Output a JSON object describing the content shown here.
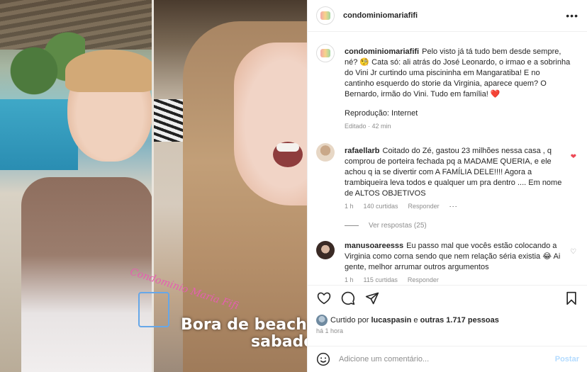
{
  "header": {
    "username": "condominiomariafifi",
    "more_icon": "more-horizontal-icon"
  },
  "media": {
    "watermark_text": "Condominio Maria Fifi",
    "overlay_line1": "Bora de beachzin",
    "overlay_line2": "sabado"
  },
  "caption": {
    "username": "condominiomariafifi",
    "text": "Pelo visto já tá tudo bem desde sempre, né? 🧐 Cata só: ali atrás do José Leonardo, o irmao e a sobrinha do Vini Jr curtindo uma piscininha em Mangaratiba! E no cantinho esquerdo do storie da Virginia, aparece quem? O Bernardo, irmão do Vini. Tudo em família! ❤️",
    "reproduction": "Reprodução: Internet",
    "edited": "Editado · 42 min"
  },
  "comments": [
    {
      "username": "rafaellarb",
      "text": "Coitado do Zé, gastou 23 milhões nessa casa , q comprou de porteira fechada pq a MADAME QUERIA, e ele achou q ia se divertir com A FAMÍLIA DELE!!!! Agora a trambiqueira leva todos e qualquer um pra dentro .... Em nome de ALTOS OBJETIVOS",
      "time": "1 h",
      "likes": "140 curtidas",
      "reply": "Responder",
      "view_replies": "Ver respostas (25)"
    },
    {
      "username": "manusoareesss",
      "text": "Eu passo mal que vocês estão colocando a Virginia como corna sendo que nem relação séria existia 😂 Ai gente, melhor arrumar outros argumentos",
      "time": "1 h",
      "likes": "115 curtidas",
      "reply": "Responder"
    }
  ],
  "likes_line": {
    "prefix": "Curtido por",
    "user": "lucaspasin",
    "middle": "e",
    "others": "outras 1.717 pessoas"
  },
  "post_time": "há 1 hora",
  "add_comment": {
    "placeholder": "Adicione um comentário...",
    "post_label": "Postar"
  },
  "colors": {
    "accent_blue": "#0095f6",
    "like_red": "#ed4956",
    "muted": "#8e8e8e"
  }
}
